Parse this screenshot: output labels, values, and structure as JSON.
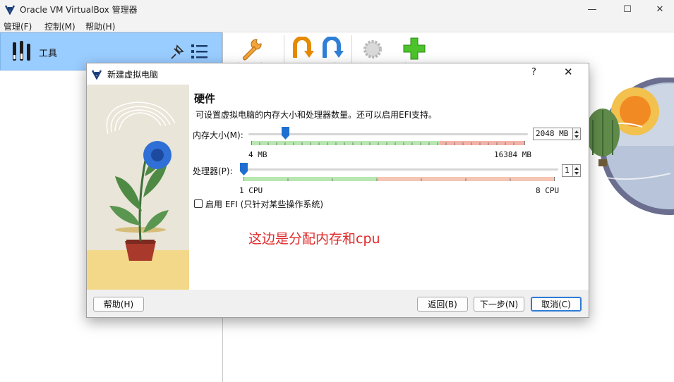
{
  "window": {
    "title": "Oracle VM VirtualBox 管理器",
    "minimize": "—",
    "maximize": "☐",
    "close": "✕"
  },
  "menu": [
    "管理(F)",
    "控制(M)",
    "帮助(H)"
  ],
  "sidebar": {
    "tools_label": "工具"
  },
  "toolbar": {
    "buttons": [
      {
        "label": "全局设定(P)",
        "icon": "wrench-icon"
      },
      {
        "label": "导入",
        "icon": "import-icon"
      },
      {
        "label": "导出",
        "icon": "export-icon"
      },
      {
        "label": "新建(N)",
        "icon": "new-icon"
      },
      {
        "label": "注册(A)",
        "icon": "add-icon"
      }
    ]
  },
  "dialog": {
    "title": "新建虚拟电脑",
    "help": "?",
    "close": "✕",
    "heading": "硬件",
    "description": "可设置虚拟电脑的内存大小和处理器数量。还可以启用EFI支持。",
    "memory": {
      "label": "内存大小(M):",
      "value": "2048 MB",
      "min_label": "4 MB",
      "max_label": "16384 MB",
      "fraction": 0.125
    },
    "cpu": {
      "label": "处理器(P):",
      "value": "1",
      "min_label": "1 CPU",
      "max_label": "8 CPU",
      "fraction": 0.0
    },
    "efi_label": "启用 EFI (只针对某些操作系统)",
    "efi_checked": false,
    "annotation": "这边是分配内存和cpu",
    "buttons": {
      "help": "帮助(H)",
      "back": "返回(B)",
      "next": "下一步(N)",
      "cancel": "取消(C)"
    }
  },
  "colors": {
    "tools_bar": "#99ccff",
    "slider_handle": "#1f6fd1",
    "zone_green": "#b9e7b1",
    "zone_red": "#f3b3a8",
    "annotation": "#e02a2a"
  }
}
